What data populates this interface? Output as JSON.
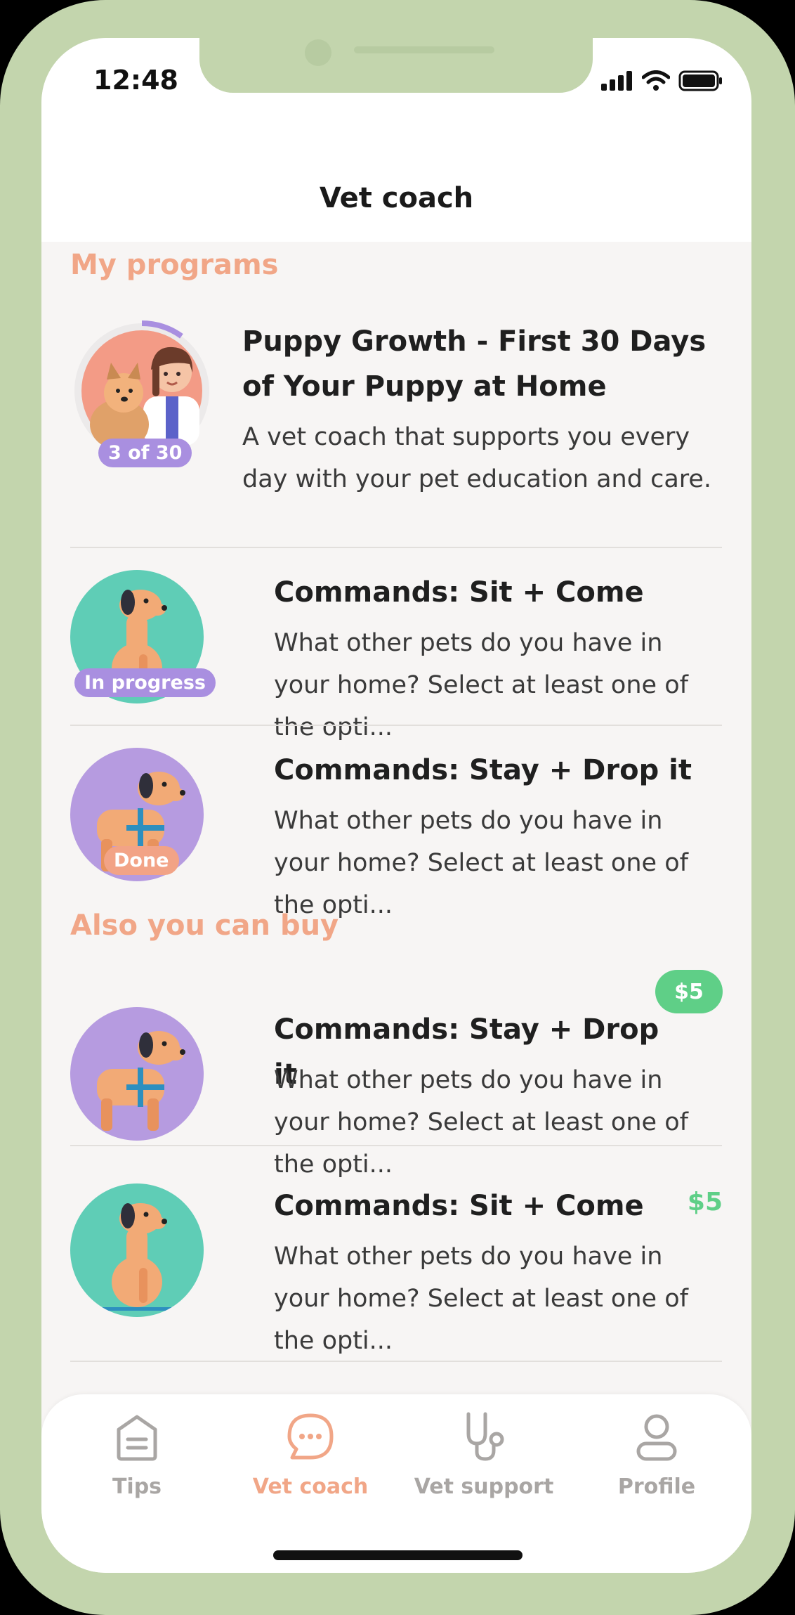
{
  "status_bar": {
    "time": "12:48"
  },
  "header": {
    "title": "Vet coach"
  },
  "sections": {
    "my_programs": "My programs",
    "also_buy": "Also you can buy"
  },
  "programs": [
    {
      "title": "Puppy Growth - First 30 Days of Your Puppy at Home",
      "description": "A vet coach that supports you every day with your pet education and care.",
      "badge": "3 of 30",
      "badge_color": "#a98fe0",
      "progress_fraction": 0.1
    },
    {
      "title": "Commands: Sit + Come",
      "description": "What other pets do you have in your home? Select at least one of the opti...",
      "badge": "In progress",
      "badge_color": "#a98fe0"
    },
    {
      "title": "Commands: Stay + Drop it",
      "description": "What other pets do you have in your home? Select at least one of the opti...",
      "badge": "Done",
      "badge_color": "#f2a386"
    }
  ],
  "shop": [
    {
      "title": "Commands: Stay + Drop it",
      "description": "What other pets do you have in your home? Select at least one of the opti...",
      "price": "$5"
    },
    {
      "title": "Commands: Sit + Come",
      "description": "What other pets do you have in your home? Select at least one of the opti...",
      "price": "$5"
    }
  ],
  "tabs": [
    {
      "label": "Tips",
      "icon": "tips-icon",
      "active": false
    },
    {
      "label": "Vet coach",
      "icon": "chat-icon",
      "active": true
    },
    {
      "label": "Vet support",
      "icon": "stethoscope-icon",
      "active": false
    },
    {
      "label": "Profile",
      "icon": "profile-icon",
      "active": false
    }
  ],
  "colors": {
    "accent": "#f1a687",
    "price": "#5fcf87",
    "teal_avatar": "#5fcdb6",
    "purple_avatar": "#b69be0",
    "frame": "#c3d5ad"
  }
}
